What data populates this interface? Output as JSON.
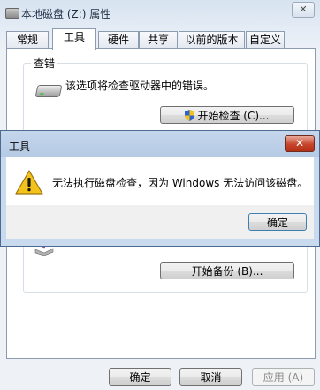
{
  "properties_window": {
    "title": "本地磁盘 (Z:) 属性",
    "close_glyph": "✕",
    "tabs": [
      {
        "label": "常规"
      },
      {
        "label": "工具"
      },
      {
        "label": "硬件"
      },
      {
        "label": "共享"
      },
      {
        "label": "以前的版本"
      },
      {
        "label": "自定义"
      }
    ],
    "active_tab": "工具",
    "error_check": {
      "group_title": "查错",
      "description": "该选项将检查驱动器中的错误。",
      "button_label": "开始检查 (C)..."
    },
    "backup": {
      "button_label": "开始备份 (B)..."
    },
    "footer": {
      "ok_label": "确定",
      "cancel_label": "取消",
      "apply_label": "应用 (A)"
    }
  },
  "error_dialog": {
    "title": "工具",
    "close_glyph": "✕",
    "message": "无法执行磁盘检查，因为 Windows 无法访问该磁盘。",
    "ok_label": "确定",
    "icon": "warning-icon",
    "colors": {
      "close_red": "#c7452b",
      "warning_yellow": "#f3c31b"
    }
  }
}
